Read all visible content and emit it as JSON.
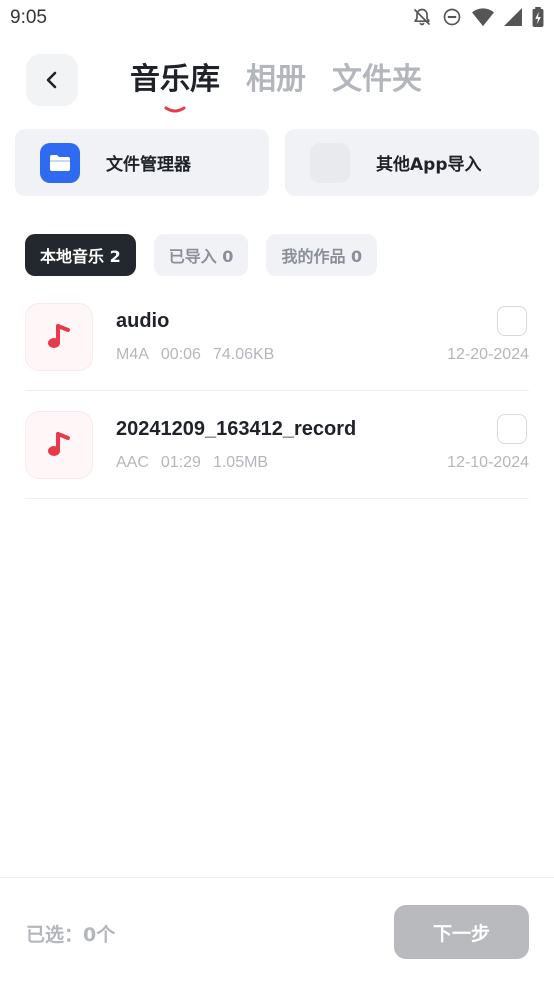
{
  "status_bar": {
    "time": "9:05"
  },
  "header": {
    "tabs": [
      {
        "label": "音乐库",
        "active": true
      },
      {
        "label": "相册",
        "active": false
      },
      {
        "label": "文件夹",
        "active": false
      }
    ]
  },
  "sources": [
    {
      "label": "文件管理器",
      "icon": "folder-icon"
    },
    {
      "label": "其他App导入",
      "icon": "apps-icon"
    }
  ],
  "filters": [
    {
      "label": "本地音乐 2",
      "active": true
    },
    {
      "label": "已导入 0",
      "active": false
    },
    {
      "label": "我的作品 0",
      "active": false
    }
  ],
  "tracks": [
    {
      "name": "audio",
      "format": "M4A",
      "duration": "00:06",
      "size": "74.06KB",
      "date": "12-20-2024",
      "checked": false
    },
    {
      "name": "20241209_163412_record",
      "format": "AAC",
      "duration": "01:29",
      "size": "1.05MB",
      "date": "12-10-2024",
      "checked": false
    }
  ],
  "footer": {
    "selected_label": "已选：0个",
    "next_label": "下一步"
  },
  "colors": {
    "accent": "#e83a4a",
    "primary_dark": "#23272e",
    "disabled": "#b8babd"
  }
}
